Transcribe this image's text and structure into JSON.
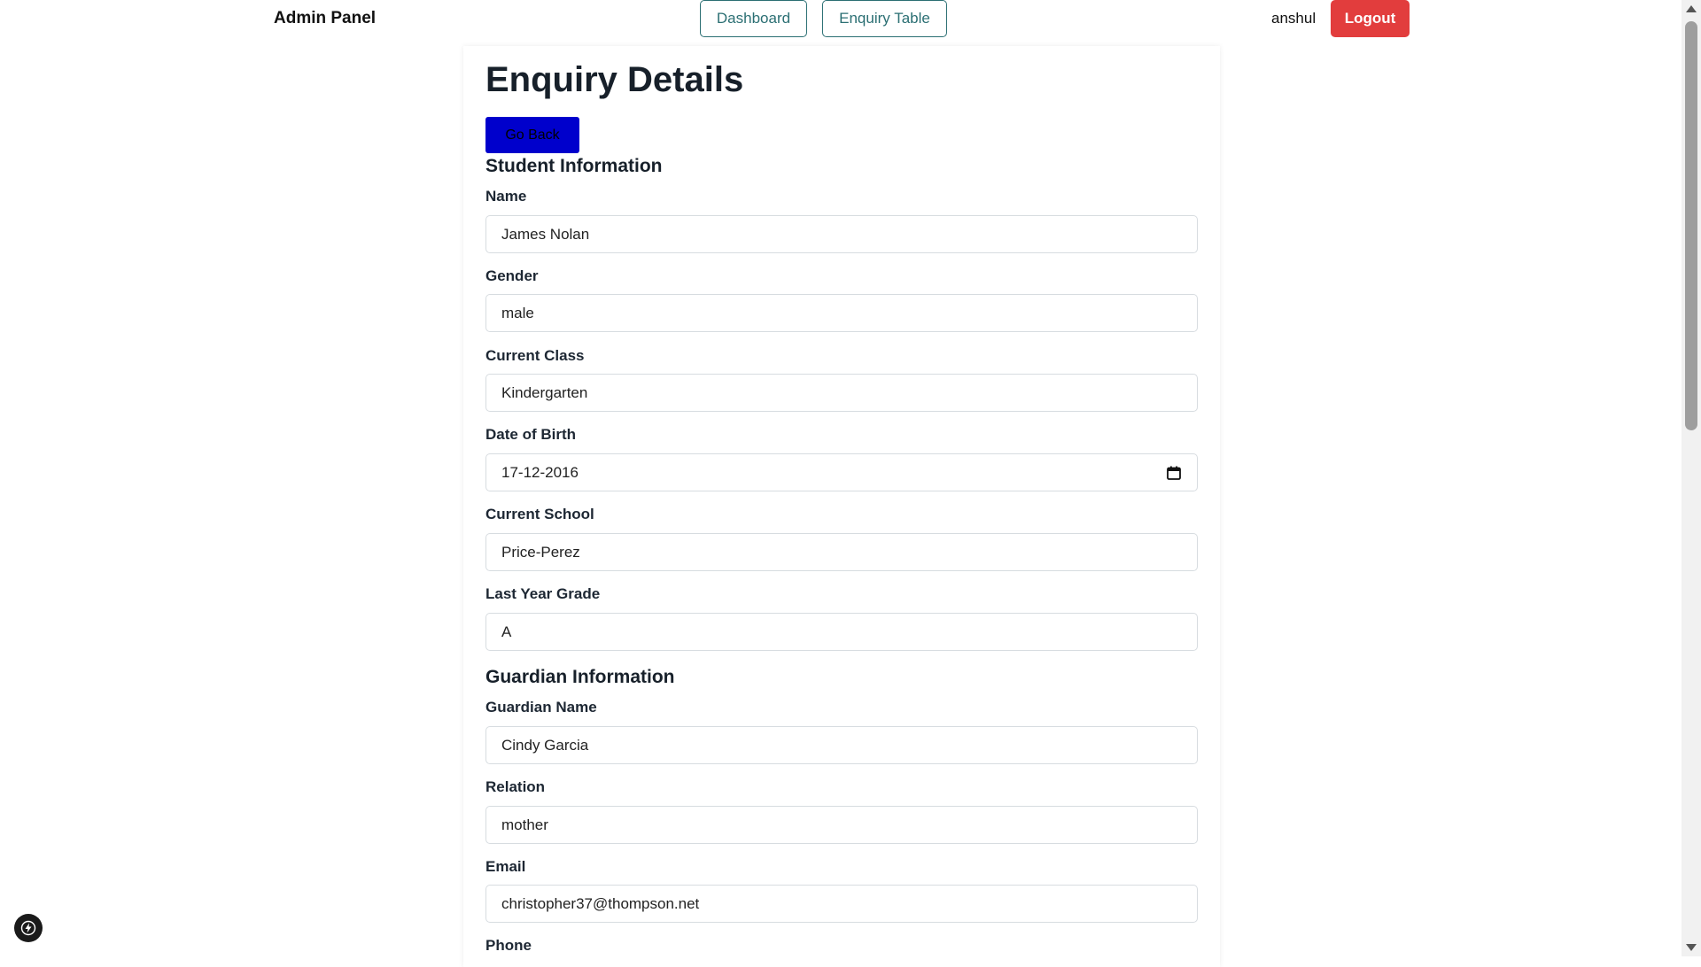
{
  "navbar": {
    "brand": "Admin Panel",
    "links": [
      "Dashboard",
      "Enquiry Table"
    ],
    "username": "anshul",
    "logout_label": "Logout"
  },
  "page": {
    "title": "Enquiry Details",
    "back_label": "Go Back"
  },
  "student": {
    "title": "Student Information",
    "fields": [
      {
        "label": "Name",
        "value": "James Nolan"
      },
      {
        "label": "Gender",
        "value": "male"
      },
      {
        "label": "Current Class",
        "value": "Kindergarten"
      },
      {
        "label": "Date of Birth",
        "value": "17-12-2016"
      },
      {
        "label": "Current School",
        "value": "Price-Perez"
      },
      {
        "label": "Last Year Grade",
        "value": "A"
      }
    ]
  },
  "guardian": {
    "title": "Guardian Information",
    "fields": [
      {
        "label": "Guardian Name",
        "value": "Cindy Garcia"
      },
      {
        "label": "Relation",
        "value": "mother"
      },
      {
        "label": "Email",
        "value": "christopher37@thompson.net"
      },
      {
        "label": "Phone",
        "value": ""
      }
    ]
  },
  "icons": {
    "calendar": "calendar-icon",
    "bolt": "lightning-icon"
  },
  "colors": {
    "nav_accent": "#2b6f73",
    "logout_bg": "#e23d3d",
    "back_bg": "#0000cc"
  }
}
